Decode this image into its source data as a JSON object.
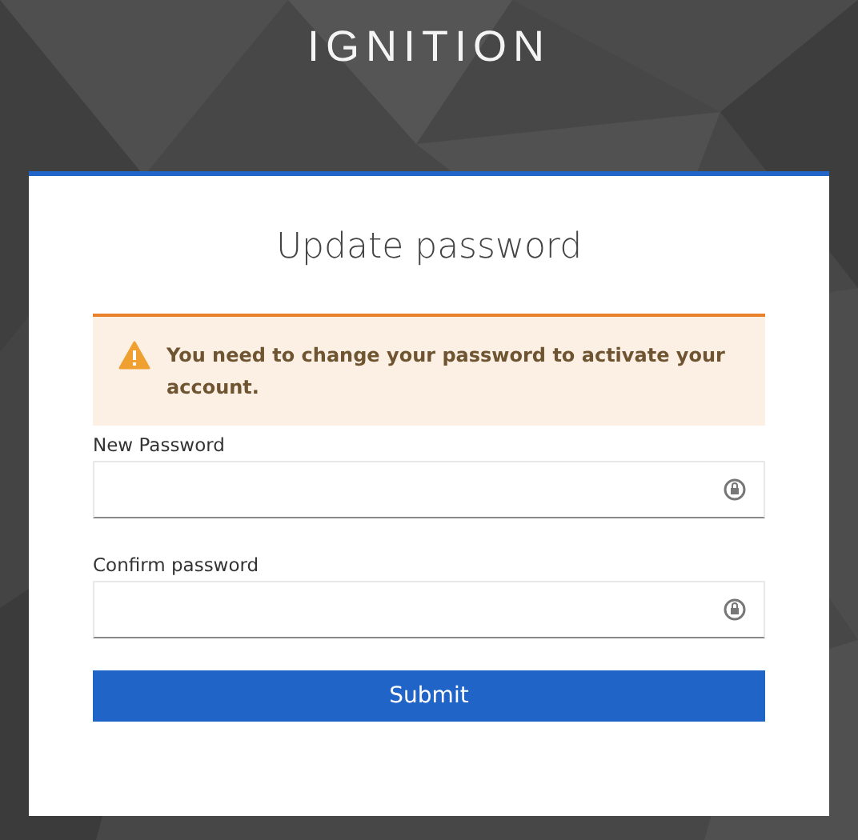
{
  "brand": "IGNITION",
  "card": {
    "title": "Update password"
  },
  "alert": {
    "message": "You need to change your password to activate your account."
  },
  "fields": [
    {
      "label": "New Password"
    },
    {
      "label": "Confirm password"
    }
  ],
  "submit": "Submit"
}
